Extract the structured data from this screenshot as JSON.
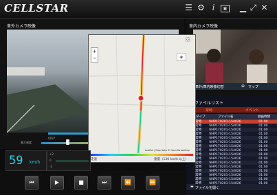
{
  "app": {
    "title": "CELLSTAR"
  },
  "titlebar_icons": [
    "list-icon",
    "settings-icon",
    "info-icon",
    "screenshot-icon",
    "minimize-icon",
    "maximize-icon",
    "close-icon"
  ],
  "front_camera": {
    "label": "車外カメラ映像"
  },
  "cabin_camera": {
    "label": "車内カメラ映像"
  },
  "switch_bar": {
    "toggle_label": "車外/車内映像切替",
    "map_label": "マップ"
  },
  "file_list": {
    "title": "ファイルリスト",
    "tabs": [
      "常時",
      "イベント"
    ],
    "columns": [
      "タイプ",
      "ファイル名",
      "録画時間"
    ],
    "rows": [
      {
        "type": "常時",
        "name": "NHP170201-154026",
        "time": "01:00"
      },
      {
        "type": "常時",
        "name": "NHP170201-154026",
        "time": "01:00"
      },
      {
        "type": "常時",
        "name": "NHP170201-154026",
        "time": "01:00"
      },
      {
        "type": "常時",
        "name": "NHP170201-154026",
        "time": "01:00"
      },
      {
        "type": "常時",
        "name": "NHP170201-154026",
        "time": "01:00"
      },
      {
        "type": "常時",
        "name": "NHP170201-154026",
        "time": "01:00"
      },
      {
        "type": "常時",
        "name": "NHP170201-154026",
        "time": "01:00"
      },
      {
        "type": "常時",
        "name": "NHP170201-154026",
        "time": "01:00"
      },
      {
        "type": "常時",
        "name": "NHP170201-154026",
        "time": "01:00"
      },
      {
        "type": "常時",
        "name": "NHP170201-154026",
        "time": "01:00"
      },
      {
        "type": "常時",
        "name": "NHP170201-154026",
        "time": "01:00"
      },
      {
        "type": "常時",
        "name": "NHP170201-154026",
        "time": "01:00"
      },
      {
        "type": "常時",
        "name": "NHP170201-154026",
        "time": "01:00"
      },
      {
        "type": "常時",
        "name": "NHP170201-154026",
        "time": "01:00"
      },
      {
        "type": "常時",
        "name": "NHP170201-154026",
        "time": "01:00"
      },
      {
        "type": "常時",
        "name": "NHP170201-154026",
        "time": "01:00"
      },
      {
        "type": "常時",
        "name": "NHP170201-154026",
        "time": "01:00"
      }
    ],
    "open_label": "ファイルを開く"
  },
  "map": {
    "attribution": "Leaflet | Map data © OpenStreetMap",
    "speed_label": "走速",
    "speed_text": "速度（130 km/h 以上）",
    "zoom_in": "+",
    "zoom_out": "−"
  },
  "speedometer": {
    "value": "59",
    "unit": "km/h"
  },
  "gsensor": {
    "label": "G",
    "ticks": [
      "+2",
      "0",
      "-2"
    ]
  },
  "timeline": {
    "start": "0837",
    "sub_label": "最大速度"
  },
  "controls": [
    "skip-prev-icon",
    "play-icon",
    "stop-icon",
    "skip-next-icon",
    "rewind-icon",
    "fast-forward-icon"
  ]
}
